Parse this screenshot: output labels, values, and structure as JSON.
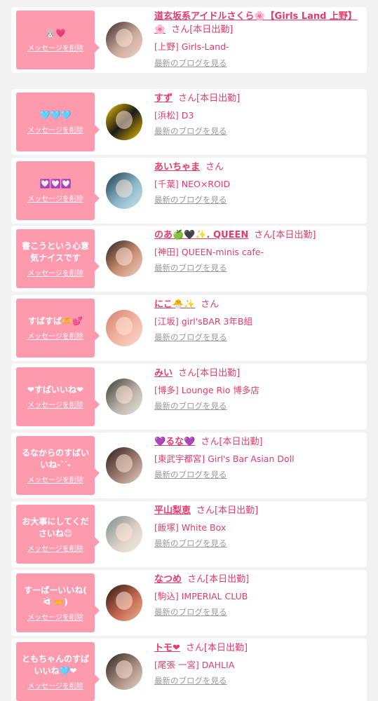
{
  "colors": {
    "accent": "#e23b6c",
    "bubble": "#fe9aae",
    "background": "#f2f2f2"
  },
  "items": [
    {
      "message": "🐰💗",
      "delete_label": "メッセージを削除",
      "name": "道玄坂系アイドルさくら🌸【Girls Land 上野】🌸",
      "san": "さん[本日出勤]",
      "shop": "[上野] Girls-Land-",
      "blog": "最新のブログを見る"
    },
    {
      "message": "🩵🩵🩵",
      "delete_label": "メッセージを削除",
      "name": "すず",
      "san": "さん[本日出勤]",
      "shop": "[浜松] D3",
      "blog": "最新のブログを見る"
    },
    {
      "message": "💟💟💟",
      "delete_label": "メッセージを削除",
      "name": "あいちゃま",
      "san": "さん",
      "shop": "[千葉] NEO×ROID",
      "blog": "最新のブログを見る"
    },
    {
      "message": "書こうという心意気ナイスです",
      "delete_label": "メッセージを削除",
      "name": "のあ🍏🖤✨. QUEEN",
      "san": "さん[本日出勤]",
      "shop": "[神田] QUEEN-minis cafe-",
      "blog": "最新のブログを見る"
    },
    {
      "message": "すばすば🫶💕",
      "delete_label": "メッセージを削除",
      "name": "にこ🐣✨",
      "san": "さん",
      "shop": "[江坂] girl'sBAR 3年B組",
      "blog": "最新のブログを見る"
    },
    {
      "message": "❤すばいいね❤",
      "delete_label": "メッセージを削除",
      "name": "みい",
      "san": "さん[本日出勤]",
      "shop": "[博多] Lounge Rio 博多店",
      "blog": "最新のブログを見る"
    },
    {
      "message": "るなからのすばいいね-`ᐝ-",
      "delete_label": "メッセージを削除",
      "name": "💜るな💜",
      "san": "さん[本日出勤]",
      "shop": "[東武宇都宮] Girl's Bar Asian Doll",
      "blog": "最新のブログを見る"
    },
    {
      "message": "お大事にしてくださいね😊",
      "delete_label": "メッセージを削除",
      "name": "平山梨恵",
      "san": "さん[本日出勤]",
      "shop": "[飯塚] White Box",
      "blog": "最新のブログを見る"
    },
    {
      "message": "すーばーいいね( ᐛ 👐)",
      "delete_label": "メッセージを削除",
      "name": "なつめ",
      "san": "さん[本日出勤]",
      "shop": "[駒込] IMPERIAL CLUB",
      "blog": "最新のブログを見る"
    },
    {
      "message": "ともちゃんのすばいいね🩵❤",
      "delete_label": "メッセージを削除",
      "name": "トモ❤",
      "san": "さん[本日出勤]",
      "shop": "[尾張 一宮] DAHLIA",
      "blog": "最新のブログを見る"
    }
  ]
}
